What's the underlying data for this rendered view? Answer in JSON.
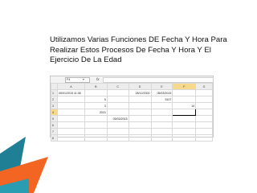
{
  "slide": {
    "title_lines": [
      "Utilizamos Varias Funciones DE Fecha Y Hora Para",
      "Realizar Estos Procesos De Fecha Y Hora Y El",
      "Ejercicio De  La Edad"
    ]
  },
  "sheet": {
    "name_box": "F4",
    "fx_label": "fx",
    "columns": [
      "A",
      "B",
      "C",
      "D",
      "E",
      "F",
      "G"
    ],
    "rows": [
      {
        "num": "1",
        "cells": [
          "05/01/2015 11:38",
          "",
          "",
          "28/12/2000",
          "05/03/2015",
          "",
          ""
        ]
      },
      {
        "num": "2",
        "cells": [
          "",
          "5",
          "",
          "",
          "5107",
          "",
          ""
        ]
      },
      {
        "num": "3",
        "cells": [
          "",
          "3",
          "",
          "",
          "",
          "14",
          ""
        ]
      },
      {
        "num": "4",
        "cells": [
          "",
          "2015",
          "",
          "",
          "",
          "",
          ""
        ]
      },
      {
        "num": "5",
        "cells": [
          "",
          "",
          "05/03/2015",
          "",
          "",
          "",
          ""
        ]
      },
      {
        "num": "6",
        "cells": [
          "",
          "",
          "",
          "",
          "",
          "",
          ""
        ]
      },
      {
        "num": "7",
        "cells": [
          "",
          "",
          "",
          "",
          "",
          "",
          ""
        ]
      },
      {
        "num": "8",
        "cells": [
          "",
          "",
          "",
          "",
          "",
          "",
          ""
        ]
      }
    ]
  },
  "colors": {
    "teal": "#1f7f94",
    "orange": "#f26522",
    "selected_header": "#f7d98b"
  }
}
